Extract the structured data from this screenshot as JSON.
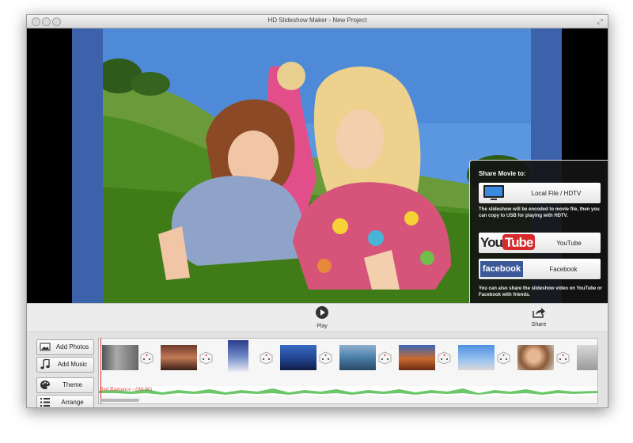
{
  "window": {
    "title": "HD Slideshow Maker - New Project"
  },
  "preview": {
    "description_colors": {
      "band": "#3d62ac",
      "sky": "#5b97e0",
      "grass": "#4d8c22"
    }
  },
  "share_popover": {
    "title": "Share Movie to:",
    "local_label": "Local File / HDTV",
    "local_note": "The slideshow will be encoded to movie file, then you can copy to USB for playing with HDTV.",
    "youtube_label": "YouTube",
    "youtube_logo_you": "You",
    "youtube_logo_tube": "Tube",
    "facebook_label": "Facebook",
    "facebook_logo": "facebook",
    "bottom_note": "You can also share the slideshow video on YouTube or Facebook with friends."
  },
  "controls": {
    "play_label": "Play",
    "share_label": "Share"
  },
  "sidebar": {
    "add_photos": "Add Photos",
    "add_music": "Add Music",
    "theme": "Theme",
    "arrange": "Arrange"
  },
  "timeline": {
    "music_track_label": "Bad Romance - (04:56)"
  }
}
